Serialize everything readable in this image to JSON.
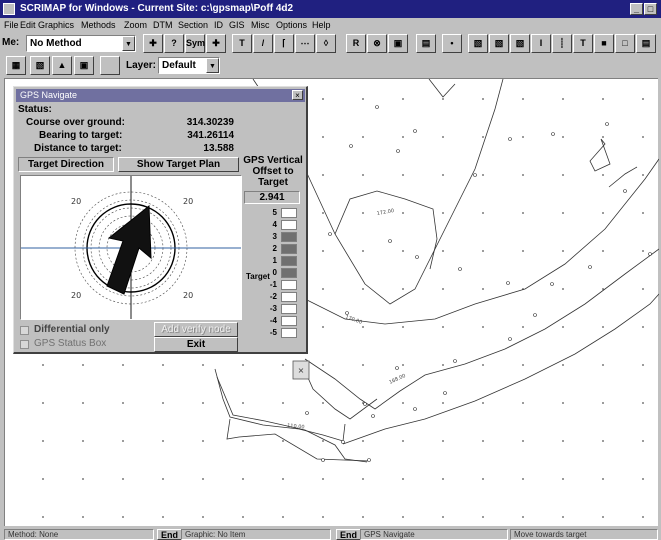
{
  "window": {
    "title": "SCRIMAP for Windows - Current Site: c:\\gpsmap\\Poff 4d2",
    "buttons": [
      "_",
      "□",
      "×"
    ]
  },
  "menu": [
    "File",
    "Edit",
    "Graphics",
    "Methods",
    "Zoom",
    "DTM",
    "Section",
    "ID",
    "GIS",
    "Misc",
    "Options",
    "Help"
  ],
  "toolbar": {
    "method_label": "Me:",
    "method_value": "No Method",
    "sym_label": "Sym",
    "r_label": "R",
    "layer_label": "Layer:",
    "layer_value": "Default"
  },
  "gps_dialog": {
    "title": "GPS Navigate",
    "close": "×",
    "status_label": "Status:",
    "course_label": "Course over ground:",
    "course_value": "314.30239",
    "bearing_label": "Bearing to target:",
    "bearing_value": "341.26114",
    "distance_label": "Distance to target:",
    "distance_value": "13.588",
    "target_direction_btn": "Target Direction",
    "show_plan_btn": "Show Target Plan",
    "vertical_title": "GPS Vertical Offset to Target",
    "vertical_value": "2.941",
    "target_label": "Target",
    "plot_ring_labels": [
      "20",
      "20",
      "20",
      "20"
    ],
    "gauge": [
      {
        "n": "5",
        "on": false
      },
      {
        "n": "4",
        "on": false
      },
      {
        "n": "3",
        "on": true
      },
      {
        "n": "2",
        "on": true
      },
      {
        "n": "1",
        "on": true
      },
      {
        "n": "0",
        "on": true
      },
      {
        "n": "-1",
        "on": false
      },
      {
        "n": "-2",
        "on": false
      },
      {
        "n": "-3",
        "on": false
      },
      {
        "n": "-4",
        "on": false
      },
      {
        "n": "-5",
        "on": false
      }
    ],
    "differential_label": "Differential only",
    "status_box_label": "GPS Status Box",
    "add_node_btn": "Add verify node",
    "exit_btn": "Exit"
  },
  "statusbar": {
    "method": "Method: None",
    "end1": "End",
    "graphic": "Graphic: No Item",
    "end2": "End",
    "gps": "GPS Navigate",
    "hint": "Move towards target"
  },
  "colors": {
    "titlebar": "#202080",
    "dialog_title": "#7070a0",
    "face": "#c0c0c0"
  }
}
